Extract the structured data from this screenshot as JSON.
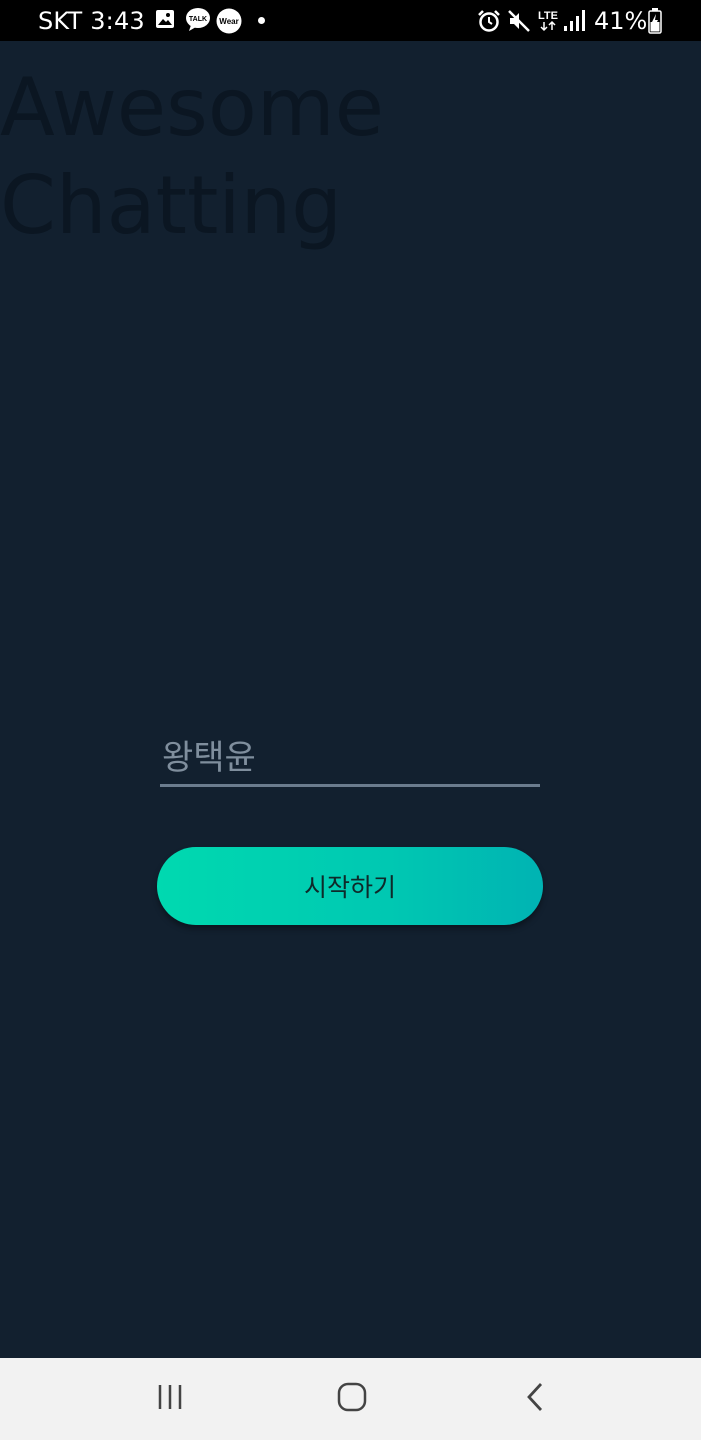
{
  "status_bar": {
    "carrier_time": "SKT 3:43",
    "network_label": "LTE",
    "battery_percent": "41%",
    "left_icons": [
      "image-icon",
      "kakaotalk-icon",
      "wear-icon",
      "dot-icon"
    ],
    "right_icons": [
      "alarm-icon",
      "mute-icon",
      "lte-icon",
      "signal-icon",
      "battery-icon"
    ],
    "talk_badge": "TALK",
    "wear_badge": "Wear"
  },
  "app": {
    "title_line1": "Awesome",
    "title_line2": "Chatting",
    "name_input": {
      "value": "",
      "placeholder": "왕택윤"
    },
    "start_button_label": "시작하기",
    "colors": {
      "background": "#12202f",
      "button_gradient_start": "#00d9b0",
      "button_gradient_end": "#00b3b3"
    }
  },
  "nav_bar": {
    "icons": [
      "recent-apps-icon",
      "home-icon",
      "back-icon"
    ]
  }
}
